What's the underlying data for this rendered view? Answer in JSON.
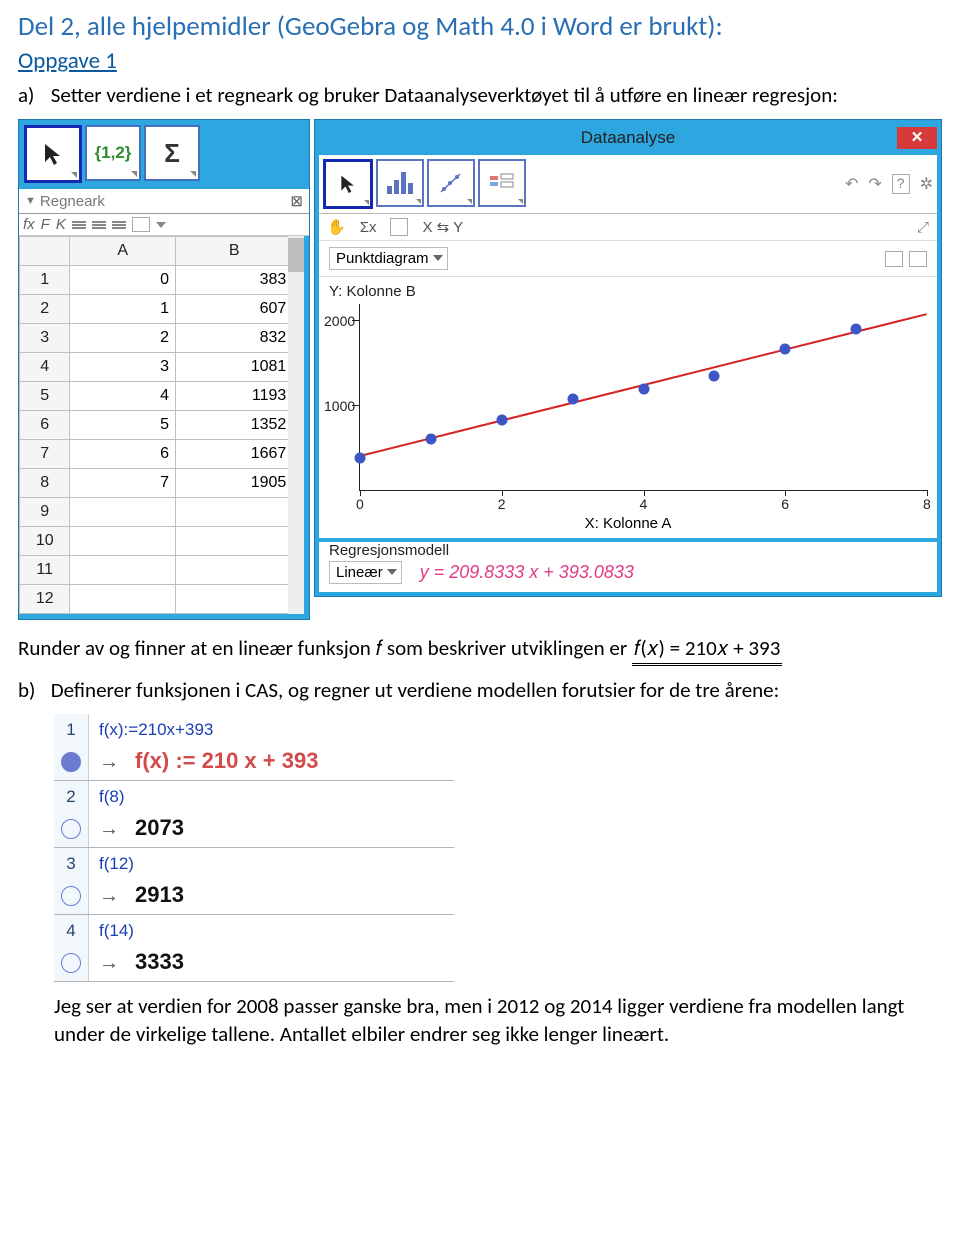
{
  "heading": "Del 2, alle hjelpemidler (GeoGebra og Math 4.0 i Word er brukt):",
  "oppgave_link": "Oppgave 1",
  "part_a": {
    "marker": "a)",
    "text": "Setter verdiene i et regneark og bruker Dataanalyseverktøyet til å utføre en lineær regresjon:"
  },
  "regneark": {
    "title": "Regneark",
    "fx": "fx",
    "bold": "F",
    "italic": "K",
    "col_a": "A",
    "col_b": "B",
    "rows": [
      {
        "n": "1",
        "a": "0",
        "b": "383"
      },
      {
        "n": "2",
        "a": "1",
        "b": "607"
      },
      {
        "n": "3",
        "a": "2",
        "b": "832"
      },
      {
        "n": "4",
        "a": "3",
        "b": "1081"
      },
      {
        "n": "5",
        "a": "4",
        "b": "1193"
      },
      {
        "n": "6",
        "a": "5",
        "b": "1352"
      },
      {
        "n": "7",
        "a": "6",
        "b": "1667"
      },
      {
        "n": "8",
        "a": "7",
        "b": "1905"
      },
      {
        "n": "9",
        "a": "",
        "b": ""
      },
      {
        "n": "10",
        "a": "",
        "b": ""
      },
      {
        "n": "11",
        "a": "",
        "b": ""
      },
      {
        "n": "12",
        "a": "",
        "b": ""
      }
    ]
  },
  "tool_set12": "{1,2}",
  "tool_sigma": "Σ",
  "da": {
    "title": "Dataanalyse",
    "sigma_x": "Σx",
    "swap": "X ⇆ Y",
    "punktdiagram": "Punktdiagram",
    "ylabel": "Y: Kolonne B",
    "xlabel": "X: Kolonne A",
    "y_ticks": [
      "2000",
      "1000"
    ],
    "x_ticks": [
      "0",
      "2",
      "4",
      "6",
      "8"
    ],
    "regresjonsmodell": "Regresjonsmodell",
    "lineaer": "Lineær",
    "equation": "y = 209.8333 x + 393.0833"
  },
  "chart_data": {
    "type": "scatter",
    "title": "",
    "xlabel": "X: Kolonne A",
    "ylabel": "Y: Kolonne B",
    "xlim": [
      0,
      8
    ],
    "ylim": [
      0,
      2200
    ],
    "x": [
      0,
      1,
      2,
      3,
      4,
      5,
      6,
      7
    ],
    "y": [
      383,
      607,
      832,
      1081,
      1193,
      1352,
      1667,
      1905
    ],
    "regression": {
      "slope": 209.8333,
      "intercept": 393.0833,
      "label": "y = 209.8333 x + 393.0833"
    }
  },
  "mid_text": {
    "pre": "Runder av og finner at en lineær funksjon 𝑓 som beskriver utviklingen er ",
    "eq": "𝑓(𝑥) = 210𝑥 + 393"
  },
  "part_b": {
    "marker": "b)",
    "text": "Definerer funksjonen i CAS, og regner ut verdiene modellen forutsier for de tre årene:"
  },
  "cas": [
    {
      "n": "1",
      "in": "f(x):=210x+393",
      "out": "f(x) := 210 x + 393",
      "red": true,
      "filled": true
    },
    {
      "n": "2",
      "in": "f(8)",
      "out": "2073",
      "red": false,
      "filled": false
    },
    {
      "n": "3",
      "in": "f(12)",
      "out": "2913",
      "red": false,
      "filled": false
    },
    {
      "n": "4",
      "in": "f(14)",
      "out": "3333",
      "red": false,
      "filled": false
    }
  ],
  "closing": "Jeg ser at verdien for 2008 passer ganske bra, men i 2012 og 2014 ligger verdiene fra modellen langt under de virkelige tallene. Antallet elbiler endrer seg ikke lenger lineært."
}
